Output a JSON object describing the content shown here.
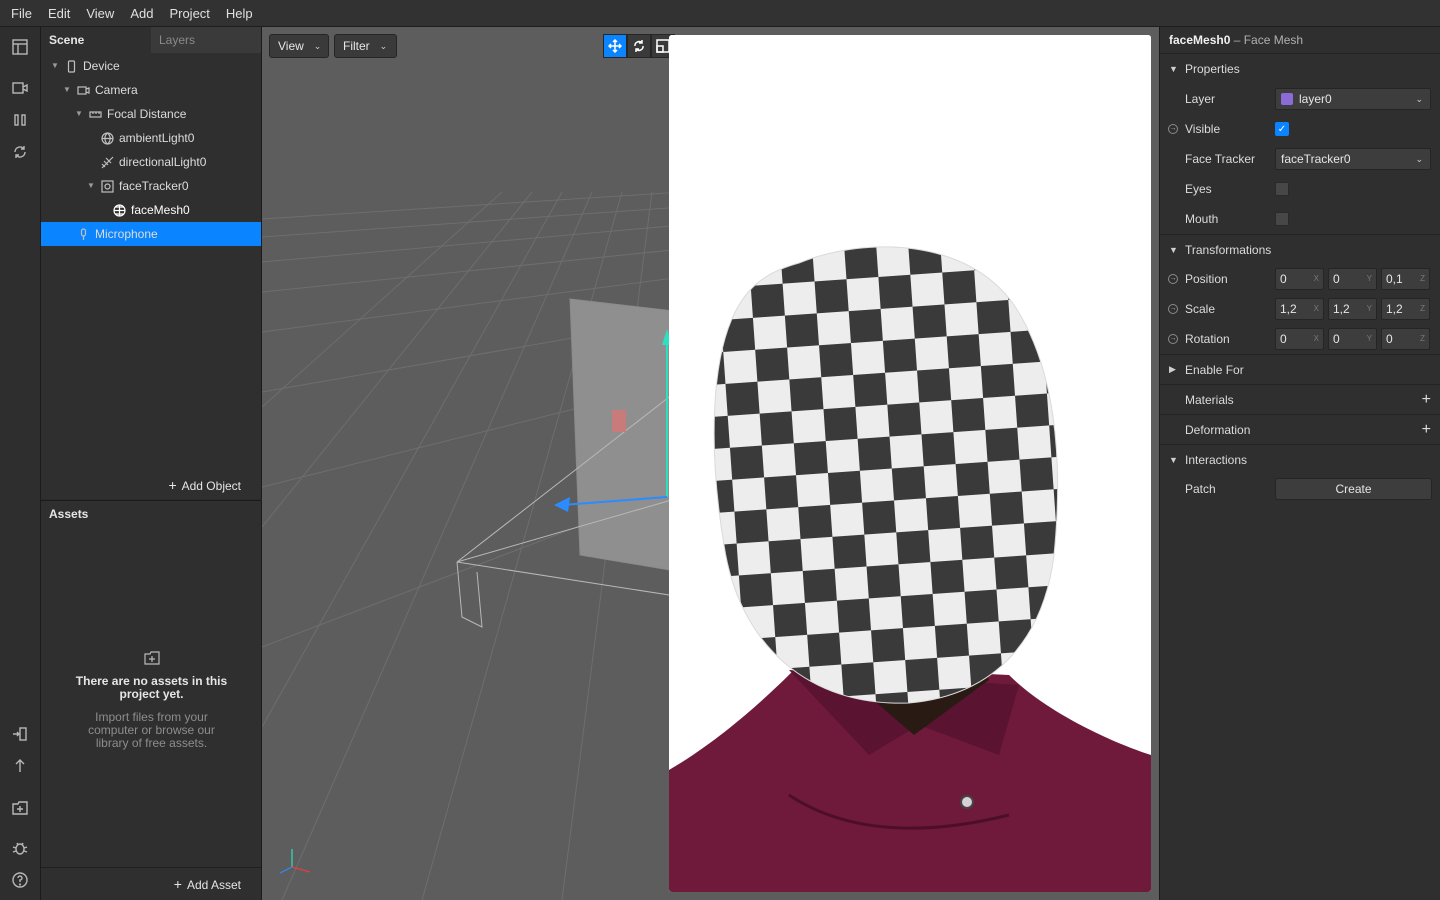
{
  "menu": [
    "File",
    "Edit",
    "View",
    "Add",
    "Project",
    "Help"
  ],
  "scene_panel": {
    "tabs": [
      "Scene",
      "Layers"
    ],
    "tree": [
      {
        "label": "Device",
        "icon": "device-icon"
      },
      {
        "label": "Camera",
        "icon": "camera-icon"
      },
      {
        "label": "Focal Distance",
        "icon": "focal-distance-icon"
      },
      {
        "label": "ambientLight0",
        "icon": "ambient-light-icon"
      },
      {
        "label": "directionalLight0",
        "icon": "directional-light-icon"
      },
      {
        "label": "faceTracker0",
        "icon": "face-tracker-icon"
      },
      {
        "label": "faceMesh0",
        "icon": "face-mesh-icon",
        "selected": true
      },
      {
        "label": "Microphone",
        "icon": "microphone-icon"
      }
    ],
    "add_object": "Add Object"
  },
  "assets_panel": {
    "title": "Assets",
    "empty_heading": "There are no assets in this project yet.",
    "empty_body": "Import files from your computer or browse our library of free assets.",
    "add_asset": "Add Asset"
  },
  "viewport": {
    "view_button": "View",
    "filter_button": "Filter"
  },
  "properties": {
    "object_name": "faceMesh0",
    "object_type": "– Face Mesh",
    "sections": {
      "properties": "Properties",
      "transformations": "Transformations",
      "enable_for": "Enable For",
      "materials": "Materials",
      "deformation": "Deformation",
      "interactions": "Interactions"
    },
    "layer_label": "Layer",
    "layer_value": "layer0",
    "layer_color": "#8b6bd6",
    "visible_label": "Visible",
    "face_tracker_label": "Face Tracker",
    "face_tracker_value": "faceTracker0",
    "eyes_label": "Eyes",
    "mouth_label": "Mouth",
    "position_label": "Position",
    "position": [
      "0",
      "0",
      "0,1"
    ],
    "scale_label": "Scale",
    "scale": [
      "1,2",
      "1,2",
      "1,2"
    ],
    "rotation_label": "Rotation",
    "rotation": [
      "0",
      "0",
      "0"
    ],
    "axes": [
      "X",
      "Y",
      "Z"
    ],
    "patch_label": "Patch",
    "create_button": "Create"
  },
  "accent_color": "#0a84ff"
}
